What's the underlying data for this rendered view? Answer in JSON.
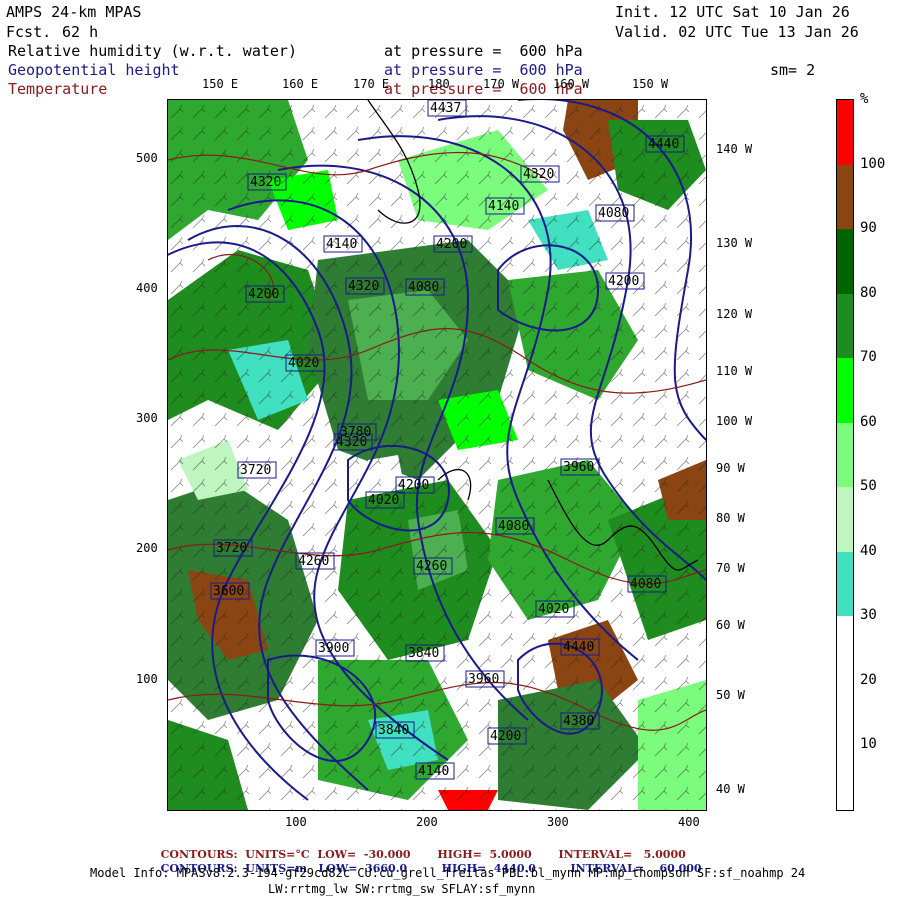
{
  "header": {
    "model": "AMPS 24-km MPAS",
    "fcst_label": "Fcst.",
    "fcst_value": "62 h",
    "init": "Init. 12 UTC Sat 10 Jan 26",
    "valid": "Valid. 02 UTC Tue 13 Jan 26"
  },
  "fields": [
    {
      "name": "Relative humidity (w.r.t. water)",
      "level": "at pressure =  600 hPa",
      "color": "#000000"
    },
    {
      "name": "Geopotential height",
      "level": "at pressure =  600 hPa",
      "color": "#1a1a8c"
    },
    {
      "name": "Temperature",
      "level": "at pressure =  600 hPa",
      "color": "#8b1a1a"
    }
  ],
  "smoothing": "sm= 2",
  "map": {
    "top_lon_labels": [
      "150 E",
      "160 E",
      "170 E",
      "180",
      "170 W",
      "160 W",
      "150 W"
    ],
    "right_lon_labels": [
      "140 W",
      "130 W",
      "120 W",
      "110 W",
      "100 W",
      "90 W",
      "80 W",
      "70 W",
      "60 W",
      "50 W",
      "40 W"
    ],
    "y_axis": [
      "500",
      "400",
      "300",
      "200",
      "100"
    ],
    "x_axis": [
      "100",
      "200",
      "300",
      "400"
    ],
    "height_labels": [
      "4437",
      "4440",
      "4320",
      "4140",
      "4080",
      "4320",
      "4200",
      "4140",
      "4200",
      "4080",
      "4020",
      "4320",
      "3780",
      "3720",
      "3960",
      "4020",
      "4080",
      "4200",
      "4260",
      "3900",
      "3840",
      "4020",
      "4380",
      "4200",
      "4140",
      "3960",
      "4440",
      "3840",
      "4080",
      "3720",
      "4320",
      "3600",
      "4260",
      "4200"
    ]
  },
  "colorbar": {
    "unit": "%",
    "ticks": [
      "100",
      "90",
      "80",
      "70",
      "60",
      "50",
      "40",
      "30",
      "20",
      "10"
    ],
    "colors": [
      "#ff0000",
      "#8b4513",
      "#006400",
      "#1e8c1e",
      "#00ff00",
      "#7cfc7c",
      "#bff5bf",
      "#40e0c0",
      "#ffffff"
    ]
  },
  "footer": {
    "temp_contours": {
      "label": "CONTOURS:",
      "units": "UNITS=°C",
      "low": "LOW=  -30.000",
      "high": "HIGH=  5.0000",
      "interval": "INTERVAL=   5.0000",
      "color": "#8b1a1a"
    },
    "height_contours": {
      "label": "CONTOURS:",
      "units": "UNITS=m",
      "low": "LOW=  3660.0",
      "high": "HIGH=  4440.0",
      "interval": "INTERVAL=    60.000",
      "color": "#1a1a8c"
    },
    "model_info_1": "Model Info: MPASv8.2.3-194-gf29cd82c CU:cu_grell_freitas PBL:bl_mynn MP:mp_thompson SF:sf_noahmp 24",
    "model_info_2": "LW:rrtmg_lw SW:rrtmg_sw SFLAY:sf_mynn"
  }
}
